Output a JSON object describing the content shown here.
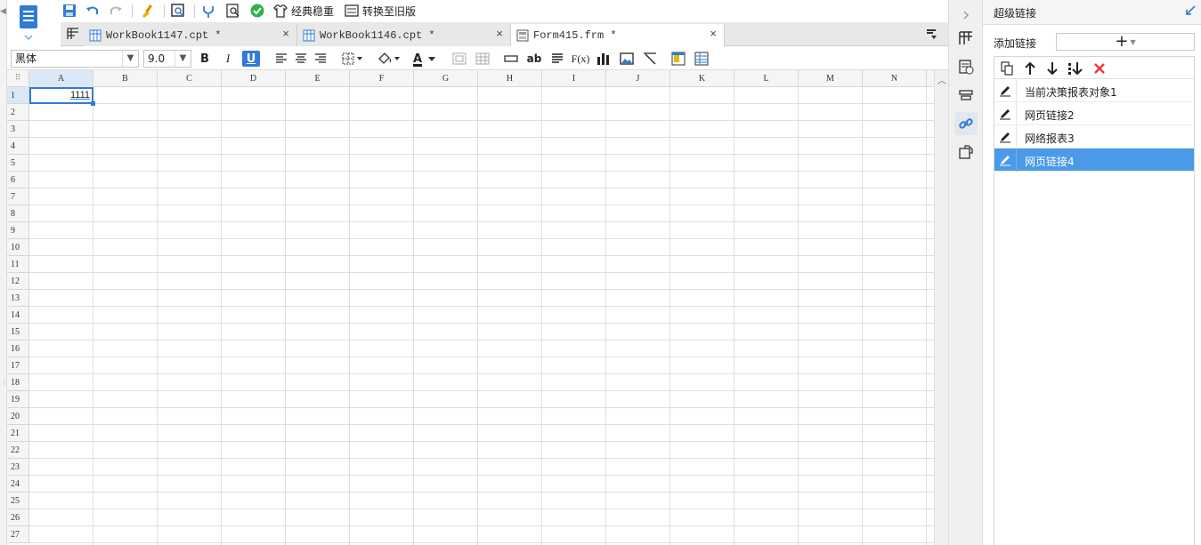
{
  "toolbar": {
    "classic_style_label": "经典稳重",
    "convert_old_label": "转换至旧版"
  },
  "tabs": [
    {
      "label": "WorkBook1147.cpt *",
      "close": "×"
    },
    {
      "label": "WorkBook1146.cpt *",
      "close": "×"
    },
    {
      "label": "Form415.frm *",
      "close": "×"
    }
  ],
  "format": {
    "font_family": "黑体",
    "font_size": "9.0",
    "bold": "B",
    "italic": "I",
    "underline": "U",
    "font_color_letter": "A",
    "text_tool": "ab",
    "formula_tool": "F(x)"
  },
  "grid": {
    "columns": [
      "A",
      "B",
      "C",
      "D",
      "E",
      "F",
      "G",
      "H",
      "I",
      "J",
      "K",
      "L",
      "M",
      "N"
    ],
    "selected_column": "A",
    "rows": [
      "1",
      "2",
      "3",
      "4",
      "5",
      "6",
      "7",
      "8",
      "9",
      "10",
      "11",
      "12",
      "13",
      "14",
      "15",
      "16",
      "17",
      "18",
      "19",
      "20",
      "21",
      "22",
      "23",
      "24",
      "25",
      "26",
      "27"
    ],
    "cell_a1_value": "1111"
  },
  "panel": {
    "title": "超级链接",
    "add_label": "添加链接",
    "add_button": "+",
    "links": [
      {
        "label": "当前决策报表对象1",
        "selected": false
      },
      {
        "label": "网页链接2",
        "selected": false
      },
      {
        "label": "网络报表3",
        "selected": false
      },
      {
        "label": "网页链接4",
        "selected": true
      }
    ]
  },
  "colors": {
    "accent": "#2f7bd6",
    "selection_row": "#4a9ae8",
    "delete_red": "#e53935",
    "check_green": "#2db24a"
  }
}
